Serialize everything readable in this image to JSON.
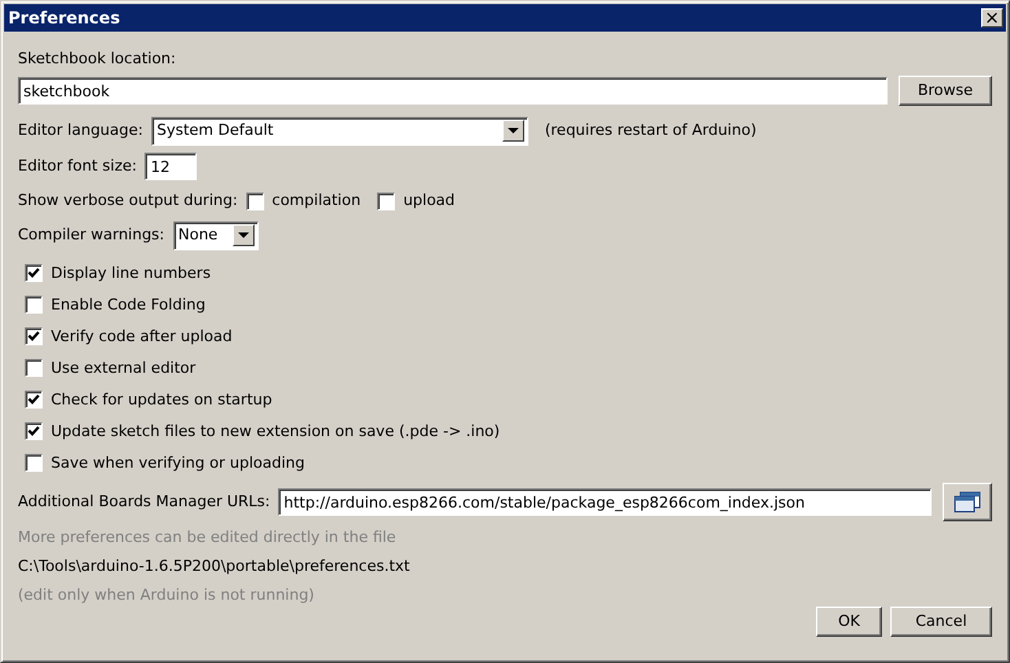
{
  "window": {
    "title": "Preferences",
    "close": "×"
  },
  "sketchbook": {
    "label": "Sketchbook location:",
    "value": "sketchbook",
    "button": "Browse"
  },
  "editor_language": {
    "label": "Editor language:",
    "value": "System Default",
    "note": "(requires restart of Arduino)"
  },
  "editor_font_size": {
    "label": "Editor font size:",
    "value": "12"
  },
  "verbose": {
    "label": "Show verbose output during:",
    "options": [
      {
        "label": "compilation",
        "checked": false
      },
      {
        "label": "upload",
        "checked": false
      }
    ]
  },
  "compiler_warnings": {
    "label": "Compiler warnings:",
    "value": "None"
  },
  "options": [
    {
      "label": "Display line numbers",
      "checked": true
    },
    {
      "label": "Enable Code Folding",
      "checked": false
    },
    {
      "label": "Verify code after upload",
      "checked": true
    },
    {
      "label": "Use external editor",
      "checked": false
    },
    {
      "label": "Check for updates on startup",
      "checked": true
    },
    {
      "label": "Update sketch files to new extension on save (.pde -> .ino)",
      "checked": true
    },
    {
      "label": "Save when verifying or uploading",
      "checked": false
    }
  ],
  "boards_urls": {
    "label": "Additional Boards Manager URLs:",
    "value": "http://arduino.esp8266.com/stable/package_esp8266com_index.json"
  },
  "info": [
    "More preferences can be edited directly in the file",
    "C:\\Tools\\arduino-1.6.5P200\\portable\\preferences.txt",
    "(edit only when Arduino is not running)"
  ],
  "buttons": [
    "OK",
    "Cancel"
  ]
}
